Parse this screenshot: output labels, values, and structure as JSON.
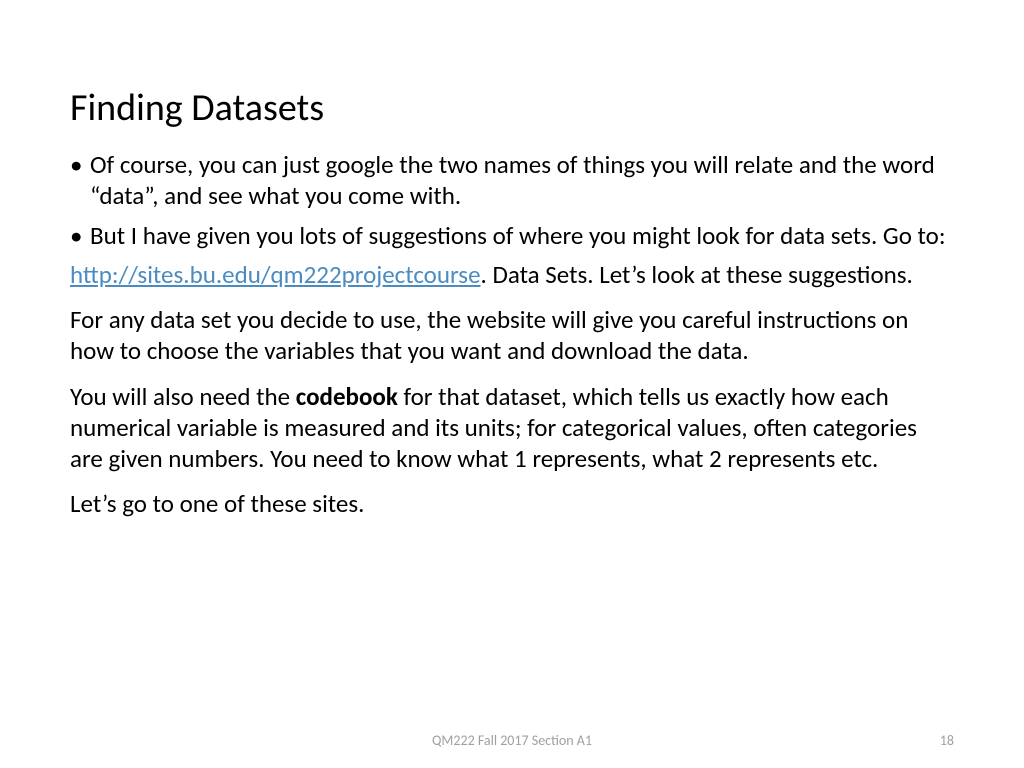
{
  "title": "Finding Datasets",
  "bullets": [
    "Of course, you can just google the two names of things you will relate and the word “data”, and see what you come with.",
    "But I have given you lots of suggestions of where you might look for data sets. Go to:"
  ],
  "link_text": "http://sites.bu.edu/qm222projectcourse",
  "after_link": ".  Data Sets.  Let’s look at these suggestions.",
  "para2": "For any data set you decide to use, the website will give you careful instructions on how to choose the variables that you want and download the data.",
  "para3_pre": "You will also need the ",
  "para3_bold": "codebook",
  "para3_post": " for that dataset, which tells us exactly how each numerical variable is measured and its units; for categorical values, often categories are given numbers. You need to know what 1 represents, what 2 represents etc.",
  "para4": "Let’s go to one of these sites.",
  "footer_center": "QM222 Fall 2017 Section A1",
  "footer_right": "18"
}
